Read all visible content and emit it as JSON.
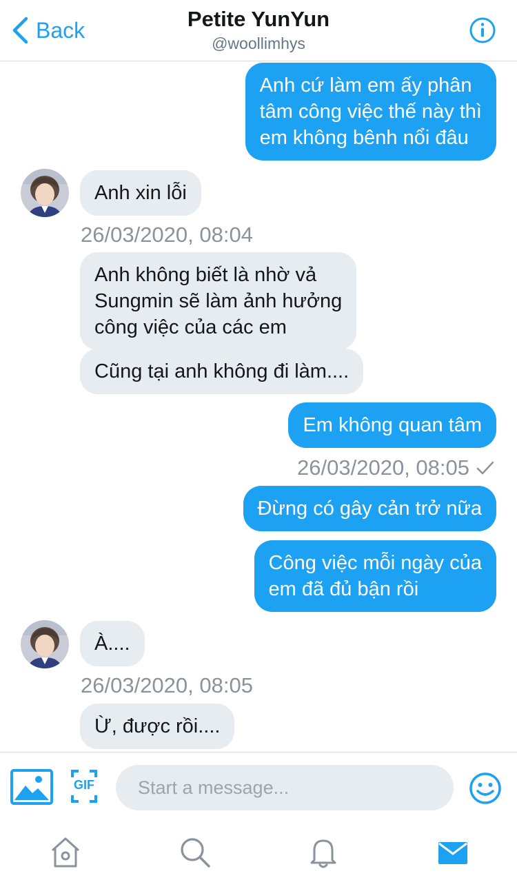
{
  "header": {
    "back_label": "Back",
    "title": "Petite YunYun",
    "handle": "@woollimhys"
  },
  "messages": [
    {
      "dir": "out",
      "lines": [
        "Anh cứ làm em ấy phân",
        "tâm công việc thế này thì",
        "em không bênh nổi đâu"
      ]
    },
    {
      "dir": "in",
      "lines": [
        "Anh xin lỗi"
      ]
    },
    {
      "timestamp": "26/03/2020, 08:04"
    },
    {
      "dir": "in",
      "lines": [
        "Anh không biết là nhờ vả",
        "Sungmin sẽ làm ảnh hưởng",
        "công việc của các em"
      ]
    },
    {
      "dir": "in",
      "lines": [
        "Cũng tại anh không đi làm...."
      ]
    },
    {
      "dir": "out",
      "lines": [
        "Em không quan tâm"
      ]
    },
    {
      "timestamp": "26/03/2020, 08:05",
      "read": true
    },
    {
      "dir": "out",
      "lines": [
        "Đừng có gây cản trở nữa"
      ]
    },
    {
      "dir": "out",
      "lines": [
        "Công việc mỗi ngày của",
        "em đã đủ bận rồi"
      ]
    },
    {
      "dir": "in",
      "lines": [
        "À...."
      ]
    },
    {
      "timestamp": "26/03/2020, 08:05"
    },
    {
      "dir": "in",
      "lines": [
        "Ừ, được rồi...."
      ]
    }
  ],
  "composer": {
    "placeholder": "Start a message...",
    "gif_label": "GIF",
    "icons": [
      "image-icon",
      "gif-icon",
      "emoji-icon"
    ]
  },
  "tabbar": {
    "icons": [
      "home-icon",
      "search-icon",
      "bell-icon",
      "mail-icon"
    ],
    "active": "mail-icon"
  },
  "colors": {
    "accent": "#1da1f2",
    "incoming_bubble": "#e6ecf0",
    "timestamp": "#8a939b"
  }
}
